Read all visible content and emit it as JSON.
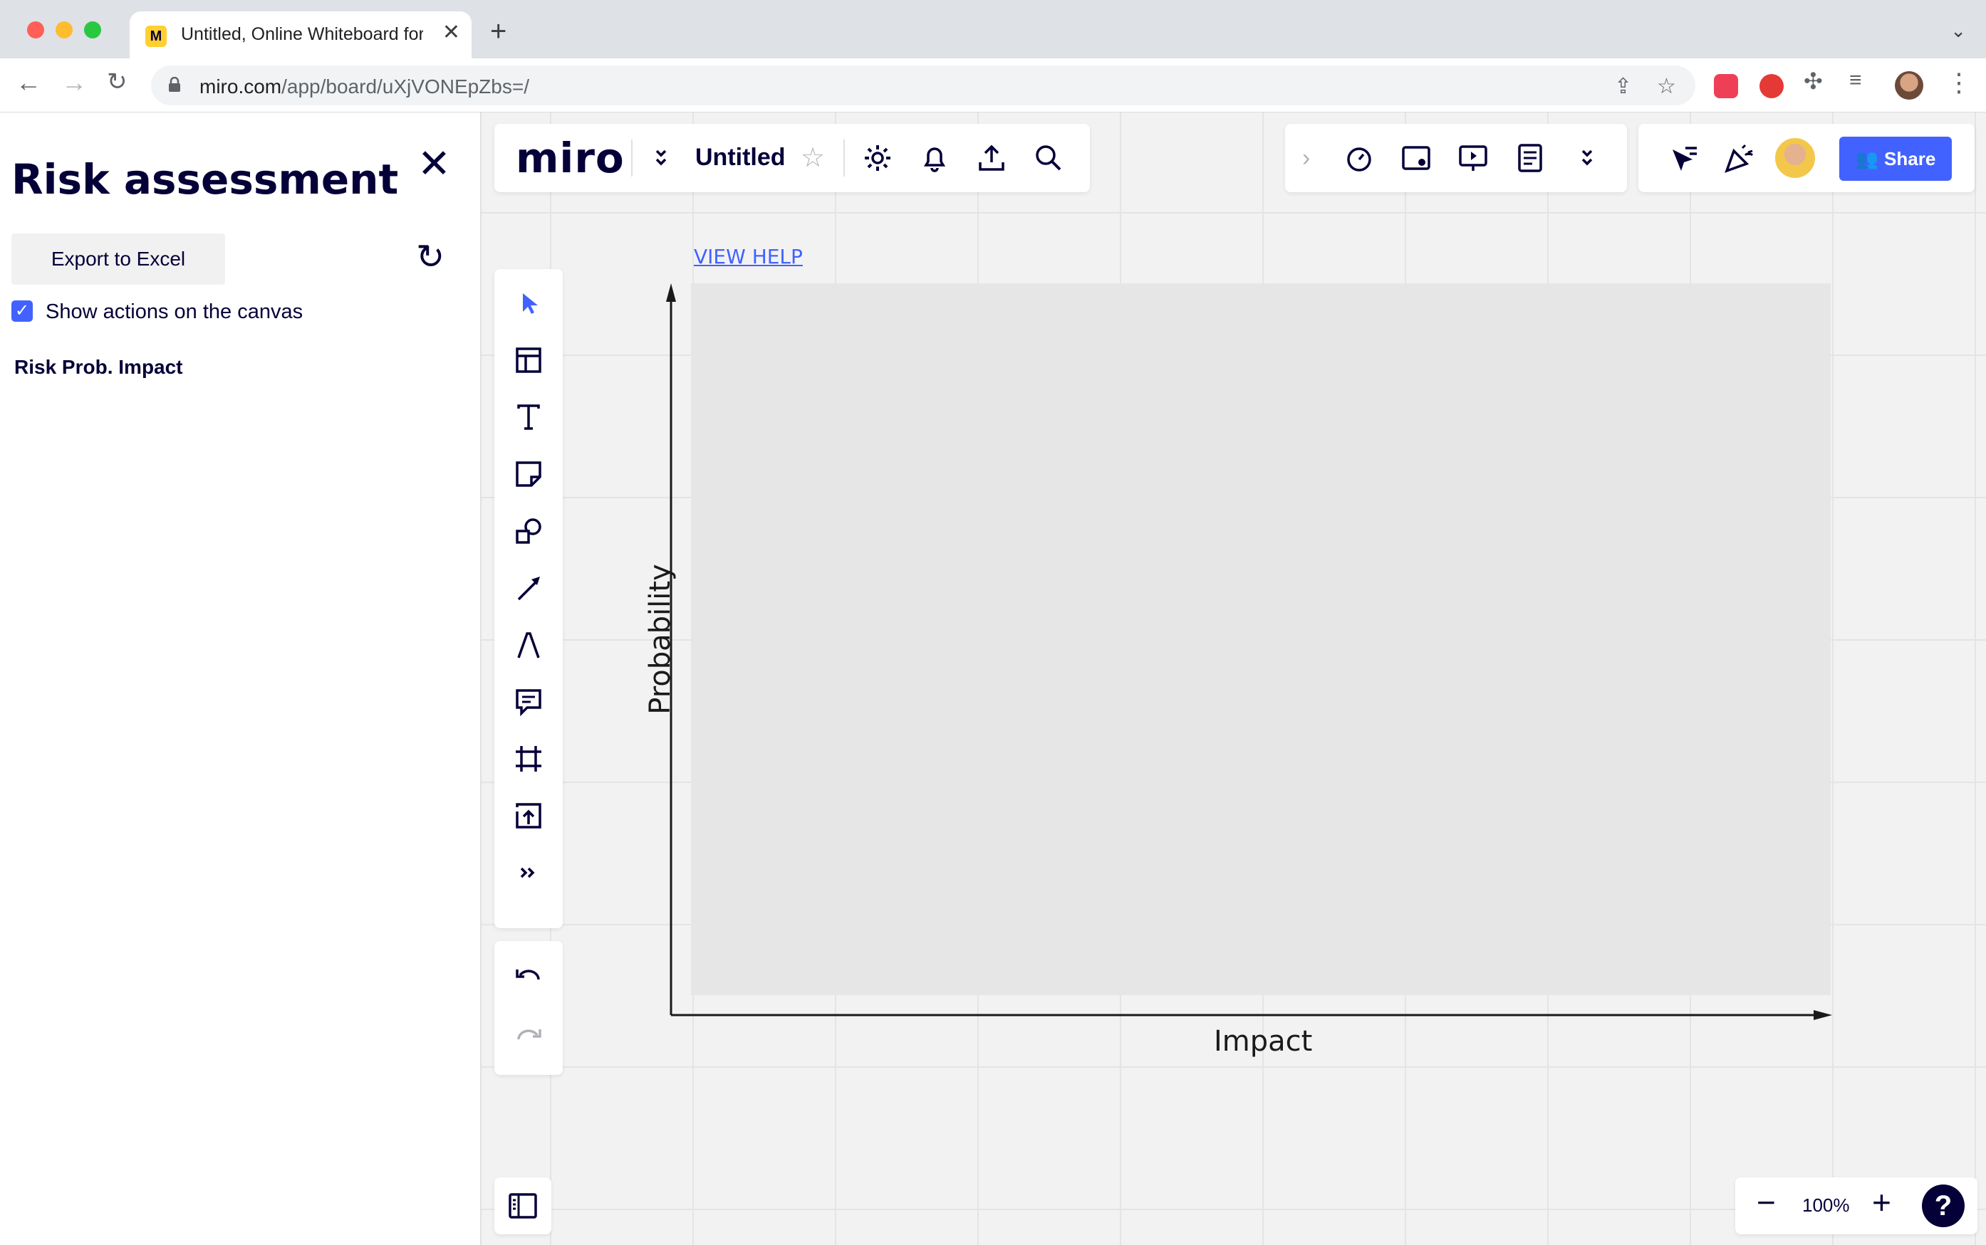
{
  "browser": {
    "tab_title": "Untitled, Online Whiteboard for",
    "favicon_letter": "M",
    "url_host": "miro.com",
    "url_path": "/app/board/uXjVONEpZbs=/"
  },
  "panel": {
    "title": "Risk assessment",
    "export_label": "Export to Excel",
    "show_actions_label": "Show actions on the canvas",
    "show_actions_checked": true,
    "table_header": "Risk Prob. Impact"
  },
  "board": {
    "logo": "miro",
    "title": "Untitled",
    "share_label": "Share",
    "view_help": "VIEW HELP"
  },
  "canvas": {
    "ylabel": "Probability",
    "xlabel": "Impact"
  },
  "zoom": {
    "value": "100%",
    "help": "?"
  },
  "colors": {
    "accent": "#4262ff",
    "ink": "#050038",
    "miro_yellow": "#ffd02f"
  },
  "icons": {
    "left_tools": [
      "select-icon",
      "templates-icon",
      "text-icon",
      "sticky-note-icon",
      "shapes-icon",
      "line-icon",
      "pen-icon",
      "comment-icon",
      "frame-icon",
      "upload-icon",
      "more-tools-icon"
    ]
  }
}
